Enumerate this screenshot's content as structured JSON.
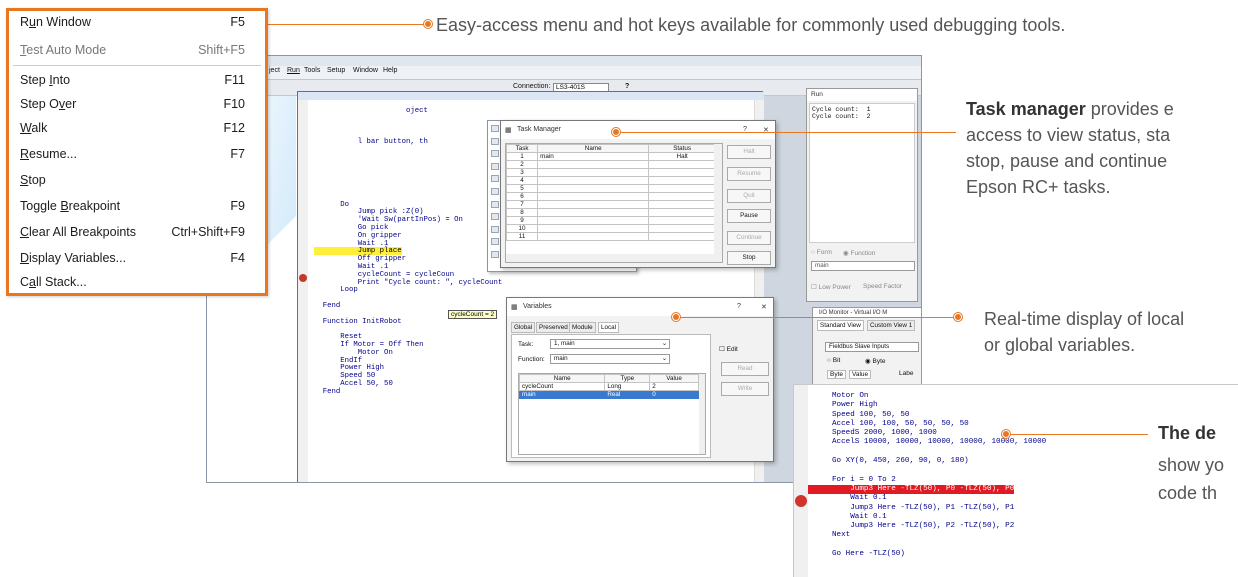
{
  "menu": {
    "items": [
      {
        "pre": "R",
        "u": "u",
        "post": "n Window",
        "key": "F5",
        "disabled": false
      },
      {
        "pre": "",
        "u": "T",
        "post": "est Auto Mode",
        "key": "Shift+F5",
        "disabled": true
      },
      {
        "pre": "Step ",
        "u": "I",
        "post": "nto",
        "key": "F11",
        "disabled": false
      },
      {
        "pre": "Step O",
        "u": "v",
        "post": "er",
        "key": "F10",
        "disabled": false
      },
      {
        "pre": "",
        "u": "W",
        "post": "alk",
        "key": "F12",
        "disabled": false
      },
      {
        "pre": "",
        "u": "R",
        "post": "esume...",
        "key": "F7",
        "disabled": false
      },
      {
        "pre": "",
        "u": "S",
        "post": "top",
        "key": "",
        "disabled": false
      },
      {
        "pre": "Toggle ",
        "u": "B",
        "post": "reakpoint",
        "key": "F9",
        "disabled": false
      },
      {
        "pre": "",
        "u": "C",
        "post": "lear All Breakpoints",
        "key": "Ctrl+Shift+F9",
        "disabled": false
      },
      {
        "pre": "",
        "u": "D",
        "post": "isplay Variables...",
        "key": "F4",
        "disabled": false
      },
      {
        "pre": "C",
        "u": "a",
        "post": "ll Stack...",
        "key": "",
        "disabled": false
      }
    ]
  },
  "callouts": {
    "menu": "Easy-access menu and hot keys available for commonly used debugging tools.",
    "task_bold": "Task manager",
    "task_rest1": " provides e",
    "task_line2": "access to view status, sta",
    "task_line3": "stop, pause and continue",
    "task_line4": "Epson RC+ tasks.",
    "vars_line1": "Real-time display of local",
    "vars_line2": "or global variables.",
    "debug_bold": "The de",
    "debug_line2": "show yo",
    "debug_line3": "code th"
  },
  "bg": {
    "menubar": [
      "ject",
      "Run",
      "Tools",
      "Setup",
      "Window",
      "Help"
    ],
    "connection_label": "Connection:",
    "connection_value": "LS3-401S",
    "help_q": "?"
  },
  "editor": {
    "lines": [
      "                     oject",
      "",
      "",
      "",
      "          l bar button, th",
      "",
      "",
      "",
      "",
      "",
      "",
      "",
      "      Do",
      "          Jump pick :Z(0)",
      "          'Wait Sw(partInPos) = On",
      "          Go pick",
      "          On gripper",
      "          Wait .1",
      "          Jump place",
      "          Off gripper",
      "          Wait .1",
      "          cycleCount = cycleCoun",
      "          Print \"Cycle count: \", cycleCount",
      "      Loop",
      "",
      "  Fend",
      "",
      "  Function InitRobot",
      "",
      "      Reset",
      "      If Motor = Off Then",
      "          Motor On",
      "      EndIf",
      "      Power High",
      "      Speed 50",
      "      Accel 50, 50",
      "  Fend"
    ],
    "tooltip": "cycleCount = 2"
  },
  "small_menu": {
    "items": [
      {
        "label": "Run Window",
        "key": "F5"
      },
      {
        "label": "Test Auto Mode",
        "key": "Shift+F5"
      },
      {
        "label": "Step Into",
        "key": "F11"
      },
      {
        "label": "Step Over",
        "key": "F10"
      },
      {
        "label": "Walk",
        "key": "F12"
      },
      {
        "label": "Resume...",
        "key": "F7"
      },
      {
        "label": "Stop",
        "key": ""
      },
      {
        "label": "Toggle Breakpoint",
        "key": "F9"
      },
      {
        "label": "Clear All Breakpoints",
        "key": "Ctrl+Shift+F9"
      },
      {
        "label": "Display Variables...",
        "key": "F4"
      },
      {
        "label": "Call Stack...",
        "key": ""
      }
    ]
  },
  "task_manager": {
    "title": "Task Manager",
    "help": "?",
    "close": "✕",
    "columns": [
      "Task",
      "Name",
      "Status"
    ],
    "rows": [
      [
        "1",
        "main",
        "Halt"
      ],
      [
        "2",
        "",
        ""
      ],
      [
        "3",
        "",
        ""
      ],
      [
        "4",
        "",
        ""
      ],
      [
        "5",
        "",
        ""
      ],
      [
        "6",
        "",
        ""
      ],
      [
        "7",
        "",
        ""
      ],
      [
        "8",
        "",
        ""
      ],
      [
        "9",
        "",
        ""
      ],
      [
        "10",
        "",
        ""
      ],
      [
        "11",
        "",
        ""
      ]
    ],
    "buttons": [
      {
        "label": "Halt",
        "disabled": true
      },
      {
        "label": "Resume",
        "disabled": true
      },
      {
        "label": "Quit",
        "disabled": true
      },
      {
        "label": "Pause",
        "disabled": false
      },
      {
        "label": "Continue",
        "disabled": true
      },
      {
        "label": "Stop",
        "disabled": false
      }
    ]
  },
  "variables": {
    "title": "Variables",
    "help": "?",
    "close": "✕",
    "tabs": [
      "Global",
      "Preserved",
      "Module",
      "Local"
    ],
    "task_label": "Task:",
    "task_value": "1, main",
    "function_label": "Function:",
    "function_value": "main",
    "edit_label": "Edit",
    "columns": [
      "Name",
      "Type",
      "Value"
    ],
    "rows": [
      {
        "name": "cycleCount",
        "type": "Long",
        "value": "2",
        "selected": false
      },
      {
        "name": "main",
        "type": "Real",
        "value": "0",
        "selected": true
      }
    ],
    "read_button": "Read",
    "write_button": "Write"
  },
  "run_window": {
    "title": "Run",
    "output": "Cycle count:  1\nCycle count:  2",
    "opt_form": "Form",
    "opt_function": "Function",
    "function_value": "main",
    "low_power": "Low Power",
    "speed_factor": "Speed Factor"
  },
  "io_monitor": {
    "title": "I/O Monitor - Virtual I/O M",
    "tabs": [
      "Standard View",
      "Custom View 1"
    ],
    "source": "Fieldbus Slave Inputs",
    "opt_bit": "Bit",
    "opt_byte": "Byte",
    "col_byte": "Byte",
    "col_value": "Value",
    "col_label": "Labe"
  },
  "code_panel": {
    "lines": [
      {
        "t": "Motor On",
        "red": false
      },
      {
        "t": "Power High",
        "red": false
      },
      {
        "t": "Speed 100, 50, 50",
        "red": false
      },
      {
        "t": "Accel 100, 100, 50, 50, 50, 50",
        "red": false
      },
      {
        "t": "SpeedS 2000, 1000, 1000",
        "red": false
      },
      {
        "t": "AccelS 10000, 10000, 10000, 10000, 10000, 10000",
        "red": false
      },
      {
        "t": "",
        "red": false
      },
      {
        "t": "Go XY(0, 450, 260, 90, 0, 180)",
        "red": false
      },
      {
        "t": "",
        "red": false
      },
      {
        "t": "For i = 0 To 2",
        "red": false
      },
      {
        "t": "    Jump3 Here -TLZ(50), P0 -TLZ(50), P0",
        "red": true
      },
      {
        "t": "    Wait 0.1",
        "red": false
      },
      {
        "t": "    Jump3 Here -TLZ(50), P1 -TLZ(50), P1",
        "red": false
      },
      {
        "t": "    Wait 0.1",
        "red": false
      },
      {
        "t": "    Jump3 Here -TLZ(50), P2 -TLZ(50), P2",
        "red": false
      },
      {
        "t": "Next",
        "red": false
      },
      {
        "t": "",
        "red": false
      },
      {
        "t": "Go Here -TLZ(50)",
        "red": false
      }
    ]
  },
  "colors": {
    "accent": "#e87722",
    "highlight": "#ffef3a",
    "breakpoint": "#e01b24"
  }
}
